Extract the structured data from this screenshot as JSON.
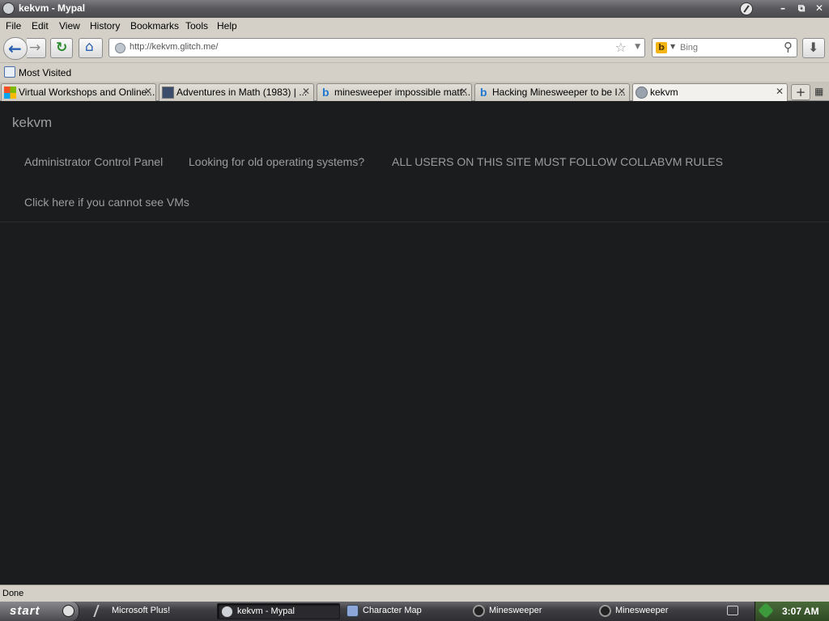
{
  "window": {
    "title": "kekvm - Mypal"
  },
  "menu": [
    "File",
    "Edit",
    "View",
    "History",
    "Bookmarks",
    "Tools",
    "Help"
  ],
  "nav": {
    "url": "http://kekvm.glitch.me/",
    "search_placeholder": "Bing"
  },
  "bookmarks": {
    "most_visited": "Most Visited"
  },
  "tabs": [
    {
      "label": "Virtual Workshops and Online...",
      "icon": "microsoft-icon"
    },
    {
      "label": "Adventures in Math (1983) | ...",
      "icon": "video-icon"
    },
    {
      "label": "minesweeper impossible matt...",
      "icon": "bing-icon"
    },
    {
      "label": "Hacking Minesweeper to be I...",
      "icon": "bing-icon"
    },
    {
      "label": "kekvm",
      "icon": "globe-icon",
      "active": true
    }
  ],
  "page": {
    "brand": "kekvm",
    "links": [
      "Administrator Control Panel",
      "Looking for old operating systems?",
      "ALL USERS ON THIS SITE MUST FOLLOW COLLABVM RULES",
      "Click here if you cannot see VMs"
    ]
  },
  "status": {
    "text": "Done"
  },
  "taskbar": {
    "start": "start",
    "tasks": [
      {
        "label": "Microsoft Plus!",
        "icon": "plus-icon"
      },
      {
        "label": "kekvm - Mypal",
        "icon": "browser-icon",
        "active": true
      },
      {
        "label": "Character Map",
        "icon": "charmap-icon"
      },
      {
        "label": "Minesweeper",
        "icon": "minesweeper-icon"
      },
      {
        "label": "Minesweeper",
        "icon": "minesweeper-icon"
      }
    ],
    "clock": "3:07 AM"
  },
  "colors": {
    "page_bg": "#1b1c1e",
    "link": "#9d9d9d",
    "chrome": "#d4d0c8"
  }
}
